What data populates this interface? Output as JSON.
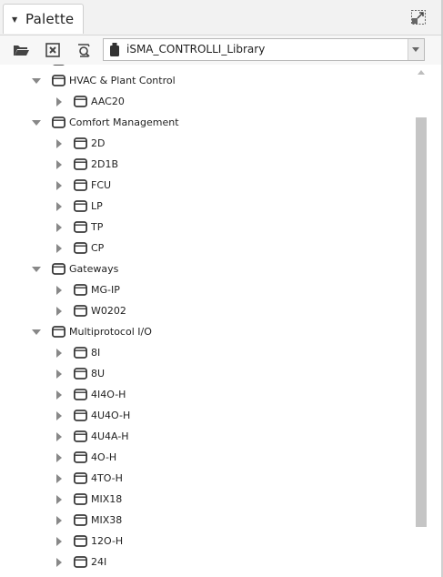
{
  "palette_tab": {
    "title": "Palette",
    "collapse_icon": "caret-down-icon",
    "maximize_icon": "maximize-icon"
  },
  "toolbar": {
    "buttons": [
      {
        "name": "open-palette-button",
        "icon": "folder-open-icon"
      },
      {
        "name": "close-palette-button",
        "icon": "close-box-icon"
      },
      {
        "name": "find-button",
        "icon": "search-refresh-icon"
      }
    ],
    "library_select": {
      "icon": "jar-icon",
      "value": "iSMA_CONTROLLI_Library"
    }
  },
  "tree": [
    {
      "level": 1,
      "label": "",
      "expanded": true,
      "partial": true
    },
    {
      "level": 1,
      "label": "HVAC & Plant Control",
      "expanded": true
    },
    {
      "level": 2,
      "label": "AAC20",
      "expanded": false
    },
    {
      "level": 1,
      "label": "Comfort Management",
      "expanded": true
    },
    {
      "level": 2,
      "label": "2D",
      "expanded": false
    },
    {
      "level": 2,
      "label": "2D1B",
      "expanded": false
    },
    {
      "level": 2,
      "label": "FCU",
      "expanded": false
    },
    {
      "level": 2,
      "label": "LP",
      "expanded": false
    },
    {
      "level": 2,
      "label": "TP",
      "expanded": false
    },
    {
      "level": 2,
      "label": "CP",
      "expanded": false
    },
    {
      "level": 1,
      "label": "Gateways",
      "expanded": true
    },
    {
      "level": 2,
      "label": "MG-IP",
      "expanded": false
    },
    {
      "level": 2,
      "label": "W0202",
      "expanded": false
    },
    {
      "level": 1,
      "label": "Multiprotocol I/O",
      "expanded": true
    },
    {
      "level": 2,
      "label": "8I",
      "expanded": false
    },
    {
      "level": 2,
      "label": "8U",
      "expanded": false
    },
    {
      "level": 2,
      "label": "4I4O-H",
      "expanded": false
    },
    {
      "level": 2,
      "label": "4U4O-H",
      "expanded": false
    },
    {
      "level": 2,
      "label": "4U4A-H",
      "expanded": false
    },
    {
      "level": 2,
      "label": "4O-H",
      "expanded": false
    },
    {
      "level": 2,
      "label": "4TO-H",
      "expanded": false
    },
    {
      "level": 2,
      "label": "MIX18",
      "expanded": false
    },
    {
      "level": 2,
      "label": "MIX38",
      "expanded": false
    },
    {
      "level": 2,
      "label": "12O-H",
      "expanded": false
    },
    {
      "level": 2,
      "label": "24I",
      "expanded": false
    }
  ],
  "scrollbar": {
    "position": 0.12,
    "visible_fraction": 0.88
  }
}
